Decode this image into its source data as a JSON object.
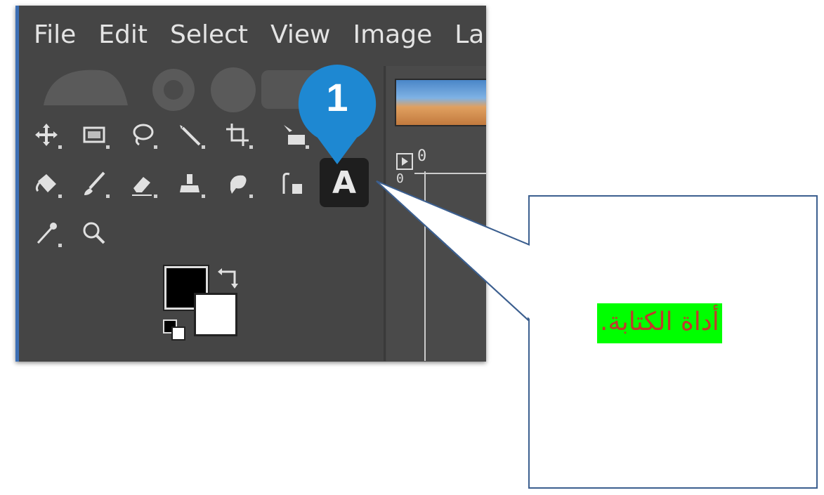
{
  "menubar": {
    "items": [
      "File",
      "Edit",
      "Select",
      "View",
      "Image",
      "La"
    ]
  },
  "toolbox": {
    "tools": [
      {
        "icon": "move-icon"
      },
      {
        "icon": "rect-select-icon"
      },
      {
        "icon": "free-select-icon"
      },
      {
        "icon": "fuzzy-select-icon"
      },
      {
        "icon": "crop-icon"
      },
      {
        "icon": "unified-transform-icon"
      },
      {
        "icon": "bucket-fill-icon"
      },
      {
        "icon": "paintbrush-icon"
      },
      {
        "icon": "eraser-icon"
      },
      {
        "icon": "clone-icon"
      },
      {
        "icon": "smudge-icon"
      },
      {
        "icon": "paths-icon"
      },
      {
        "icon": "text-tool-icon"
      },
      {
        "icon": "color-picker-icon"
      },
      {
        "icon": "zoom-icon"
      }
    ],
    "text_tool_label": "A"
  },
  "ruler": {
    "h_label": "0",
    "v_label": "0"
  },
  "badge": {
    "number": "1",
    "color": "#1e88d2"
  },
  "callout": {
    "text": "أداة الكتابة.",
    "highlight": "#00ff00",
    "text_color": "#c0392b"
  }
}
